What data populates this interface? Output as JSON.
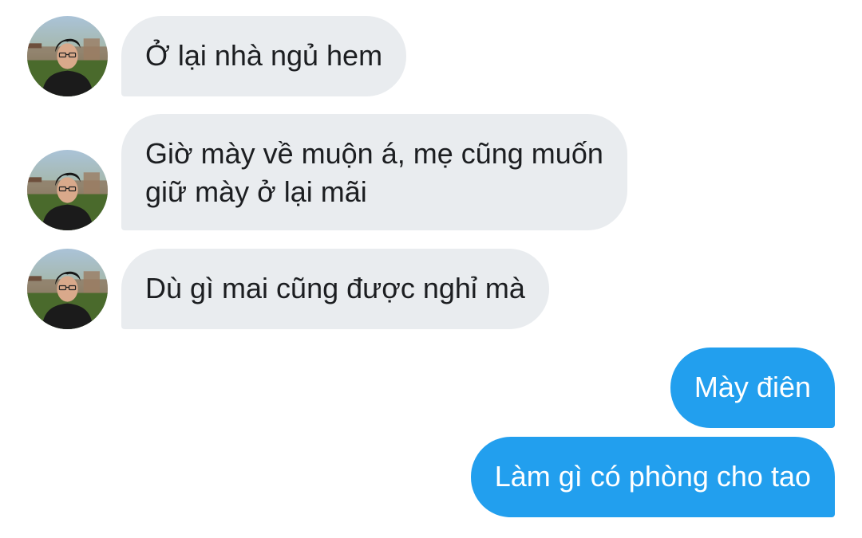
{
  "conversation": {
    "messages": [
      {
        "sender": "contact",
        "text": "Ở lại nhà ngủ hem"
      },
      {
        "sender": "contact",
        "lines": [
          "Giờ mày về muộn á, mẹ cũng muốn",
          "giữ mày ở lại mãi"
        ]
      },
      {
        "sender": "contact",
        "text": "Dù gì mai cũng được nghỉ mà"
      },
      {
        "sender": "me",
        "text": "Mày điên"
      },
      {
        "sender": "me",
        "text": "Làm gì có phòng cho tao"
      }
    ]
  },
  "colors": {
    "incoming_bubble": "#e9ecef",
    "outgoing_bubble": "#229fee",
    "incoming_text": "#1c1e21",
    "outgoing_text": "#ffffff"
  },
  "icons": {
    "contact_avatar": "user-avatar-photo"
  }
}
